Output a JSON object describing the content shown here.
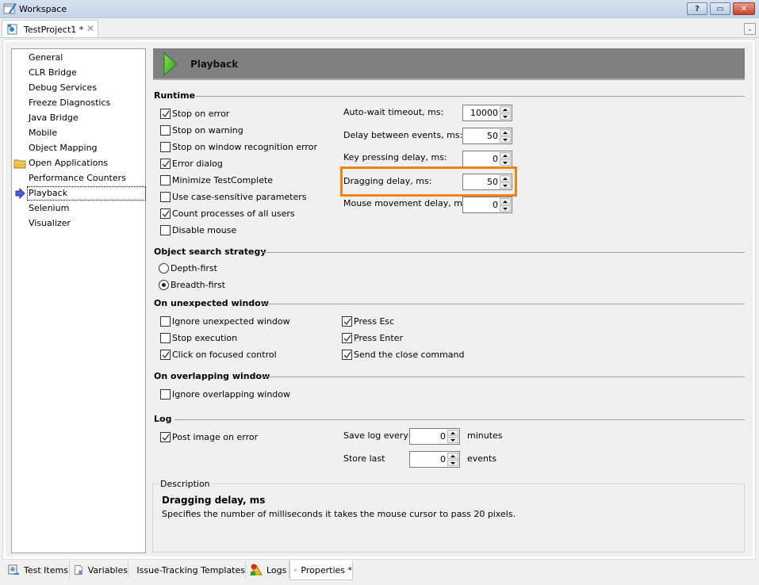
{
  "window": {
    "title": "Workspace",
    "buttons": {
      "help": "?",
      "restore": "▭",
      "close": "✕"
    }
  },
  "document_tab": {
    "label": "TestProject1 *",
    "close": "✕",
    "dropdown": "⌄"
  },
  "sidebar": {
    "items": [
      {
        "label": "General",
        "icon": null
      },
      {
        "label": "CLR Bridge",
        "icon": null
      },
      {
        "label": "Debug Services",
        "icon": null
      },
      {
        "label": "Freeze Diagnostics",
        "icon": null
      },
      {
        "label": "Java Bridge",
        "icon": null
      },
      {
        "label": "Mobile",
        "icon": null
      },
      {
        "label": "Object Mapping",
        "icon": null
      },
      {
        "label": "Open Applications",
        "icon": "folder-icon"
      },
      {
        "label": "Performance Counters",
        "icon": null
      },
      {
        "label": "Playback",
        "icon": "arrow-right-icon",
        "selected": true
      },
      {
        "label": "Selenium",
        "icon": null
      },
      {
        "label": "Visualizer",
        "icon": null
      }
    ]
  },
  "header": {
    "title": "Playback",
    "icon": "play-icon"
  },
  "runtime": {
    "title": "Runtime",
    "checkboxes": [
      {
        "label": "Stop on error",
        "checked": true
      },
      {
        "label": "Stop on warning",
        "checked": false
      },
      {
        "label": "Stop on window recognition error",
        "checked": false
      },
      {
        "label": "Error dialog",
        "checked": true
      },
      {
        "label": "Minimize TestComplete",
        "checked": false
      },
      {
        "label": "Use case-sensitive parameters",
        "checked": false
      },
      {
        "label": "Count processes of all users",
        "checked": true
      },
      {
        "label": "Disable mouse",
        "checked": false
      }
    ],
    "fields": [
      {
        "label": "Auto-wait timeout, ms:",
        "value": "10000"
      },
      {
        "label": "Delay between events, ms:",
        "value": "50"
      },
      {
        "label": "Key pressing delay, ms:",
        "value": "0"
      },
      {
        "label": "Dragging delay, ms:",
        "value": "50",
        "highlighted": true
      },
      {
        "label": "Mouse movement delay, ms:",
        "value": "0"
      }
    ]
  },
  "object_search": {
    "title": "Object search strategy",
    "options": [
      {
        "label": "Depth-first",
        "selected": false
      },
      {
        "label": "Breadth-first",
        "selected": true
      }
    ]
  },
  "unexpected_window": {
    "title": "On unexpected window",
    "left": [
      {
        "label": "Ignore unexpected window",
        "checked": false
      },
      {
        "label": "Stop execution",
        "checked": false
      },
      {
        "label": "Click on focused control",
        "checked": true
      }
    ],
    "right": [
      {
        "label": "Press Esc",
        "checked": true
      },
      {
        "label": "Press Enter",
        "checked": true
      },
      {
        "label": "Send the close command",
        "checked": true
      }
    ]
  },
  "overlapping_window": {
    "title": "On overlapping window",
    "checkboxes": [
      {
        "label": "Ignore overlapping window",
        "checked": false
      }
    ]
  },
  "log": {
    "title": "Log",
    "post_image": {
      "label": "Post image on error",
      "checked": true
    },
    "save_every": {
      "label": "Save log every",
      "value": "0",
      "unit": "minutes"
    },
    "store_last": {
      "label": "Store last",
      "value": "0",
      "unit": "events"
    }
  },
  "description": {
    "legend": "Description",
    "title": "Dragging delay, ms",
    "text": "Specifies the number of milliseconds it takes the mouse cursor to pass 20 pixels."
  },
  "bottom_tabs": [
    {
      "label": "Test Items",
      "icon": "test-items-icon"
    },
    {
      "label": "Variables",
      "icon": "variables-icon"
    },
    {
      "label": "Issue-Tracking Templates",
      "icon": "issue-tracking-icon"
    },
    {
      "label": "Logs",
      "icon": "logs-icon"
    },
    {
      "label": "Properties *",
      "icon": "properties-icon",
      "active": true
    }
  ],
  "colors": {
    "highlight": "#f0820f",
    "header_bg": "#808080",
    "play_green": "#3cb01e"
  }
}
